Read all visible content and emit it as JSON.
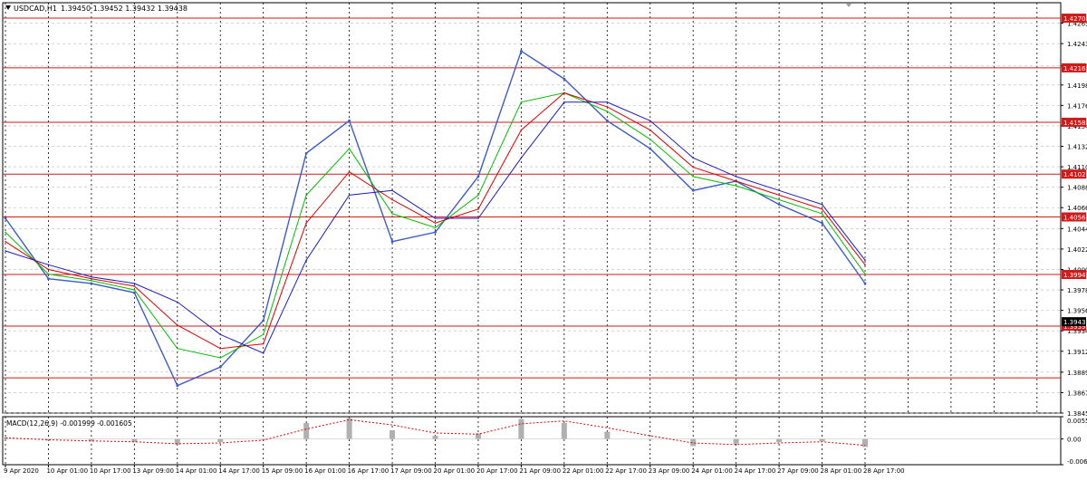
{
  "header": {
    "symbol_timeframe": "USDCAD,H1",
    "ohlc": "1.39450 1.39452 1.39432 1.39438"
  },
  "price_axis": {
    "ticks": [
      "1.42650",
      "1.42430",
      "1.42190",
      "1.41985",
      "1.41765",
      "1.41545",
      "1.41325",
      "1.41105",
      "1.40885",
      "1.40665",
      "1.40440",
      "1.40220",
      "1.40000",
      "1.39780",
      "1.39560",
      "1.39340",
      "1.39120",
      "1.38895",
      "1.38675",
      "1.38455"
    ],
    "level_labels": [
      "1.42704",
      "1.42169",
      "1.41584",
      "1.41026",
      "1.40565",
      "1.39946",
      "1.39391"
    ],
    "price_labels": [
      "1.39438",
      "1.39391"
    ]
  },
  "time_axis": {
    "labels": [
      "9 Apr 2020",
      "10 Apr 01:00",
      "10 Apr 17:00",
      "13 Apr 09:00",
      "14 Apr 01:00",
      "14 Apr 17:00",
      "15 Apr 09:00",
      "16 Apr 01:00",
      "16 Apr 17:00",
      "17 Apr 09:00",
      "20 Apr 01:00",
      "20 Apr 17:00",
      "21 Apr 09:00",
      "22 Apr 01:00",
      "22 Apr 17:00",
      "23 Apr 09:00",
      "24 Apr 01:00",
      "24 Apr 17:00",
      "27 Apr 09:00",
      "28 Apr 01:00",
      "28 Apr 17:00"
    ]
  },
  "macd": {
    "label": "MACD(12,26,9) -0.001999 -0.001605",
    "ticks": [
      "0.005572",
      "0.00",
      "-0.006440"
    ]
  },
  "colors": {
    "price_series": "#3b5ccc",
    "ma_fast": "#00c000",
    "ma_mid": "#e00000",
    "ma_slow": "#1a1acc",
    "levels": "#d11a1a",
    "macd_signal": "#e00000",
    "macd_hist": "#b0b0b0"
  },
  "chart_data": [
    {
      "type": "line",
      "title": "USDCAD,H1",
      "x": [
        "9 Apr 2020",
        "10 Apr 01:00",
        "10 Apr 17:00",
        "13 Apr 09:00",
        "14 Apr 01:00",
        "14 Apr 17:00",
        "15 Apr 09:00",
        "16 Apr 01:00",
        "16 Apr 17:00",
        "17 Apr 09:00",
        "20 Apr 01:00",
        "20 Apr 17:00",
        "21 Apr 09:00",
        "22 Apr 01:00",
        "22 Apr 17:00",
        "23 Apr 09:00",
        "24 Apr 01:00",
        "24 Apr 17:00",
        "27 Apr 09:00",
        "28 Apr 01:00",
        "28 Apr 17:00"
      ],
      "ylim": [
        1.38455,
        1.4287
      ],
      "grid": true,
      "series": [
        {
          "values": [
            1.4055,
            1.399,
            1.3985,
            1.3975,
            1.3875,
            1.3895,
            1.3945,
            1.4125,
            1.416,
            1.403,
            1.404,
            1.41,
            1.4235,
            1.4205,
            1.416,
            1.413,
            1.4085,
            1.4095,
            1.407,
            1.405,
            1.3985
          ]
        },
        {
          "values": [
            1.404,
            1.3995,
            1.3988,
            1.3978,
            1.3915,
            1.3905,
            1.393,
            1.408,
            1.413,
            1.406,
            1.4045,
            1.408,
            1.418,
            1.419,
            1.417,
            1.414,
            1.41,
            1.409,
            1.4075,
            1.406,
            1.3995
          ]
        },
        {
          "values": [
            1.403,
            1.4,
            1.399,
            1.3982,
            1.394,
            1.3915,
            1.392,
            1.405,
            1.4105,
            1.4075,
            1.405,
            1.4065,
            1.415,
            1.419,
            1.4175,
            1.415,
            1.411,
            1.4095,
            1.408,
            1.4065,
            1.4005
          ]
        },
        {
          "values": [
            1.402,
            1.4005,
            1.3992,
            1.3985,
            1.3965,
            1.393,
            1.391,
            1.401,
            1.408,
            1.4085,
            1.4055,
            1.4055,
            1.412,
            1.418,
            1.418,
            1.416,
            1.412,
            1.41,
            1.4085,
            1.407,
            1.401
          ]
        }
      ],
      "levels": [
        1.42704,
        1.42169,
        1.41584,
        1.41026,
        1.40565,
        1.39946,
        1.39391,
        1.38834
      ]
    },
    {
      "type": "bar",
      "title": "MACD(12,26,9) -0.001999 -0.001605",
      "x": [
        "9 Apr 2020",
        "10 Apr 01:00",
        "10 Apr 17:00",
        "13 Apr 09:00",
        "14 Apr 01:00",
        "14 Apr 17:00",
        "15 Apr 09:00",
        "16 Apr 01:00",
        "16 Apr 17:00",
        "17 Apr 09:00",
        "20 Apr 01:00",
        "20 Apr 17:00",
        "21 Apr 09:00",
        "22 Apr 01:00",
        "22 Apr 17:00",
        "23 Apr 09:00",
        "24 Apr 01:00",
        "24 Apr 17:00",
        "27 Apr 09:00",
        "28 Apr 01:00",
        "28 Apr 17:00"
      ],
      "ylim": [
        -0.00644,
        0.005572
      ],
      "series": [
        {
          "values": [
            0.0004,
            -0.0004,
            -0.0006,
            -0.0008,
            -0.0014,
            -0.0008,
            -0.0002,
            0.004,
            0.0052,
            0.0022,
            0.0008,
            0.0014,
            0.005,
            0.004,
            0.0018,
            0.0,
            -0.0018,
            -0.0012,
            -0.0008,
            -0.0006,
            -0.002
          ]
        },
        {
          "values": [
            0.0003,
            -0.0002,
            -0.0005,
            -0.0007,
            -0.0012,
            -0.001,
            -0.0003,
            0.0025,
            0.0048,
            0.0035,
            0.0015,
            0.0012,
            0.0038,
            0.0045,
            0.0028,
            0.0008,
            -0.001,
            -0.0014,
            -0.001,
            -0.0007,
            -0.0016
          ]
        }
      ]
    }
  ]
}
